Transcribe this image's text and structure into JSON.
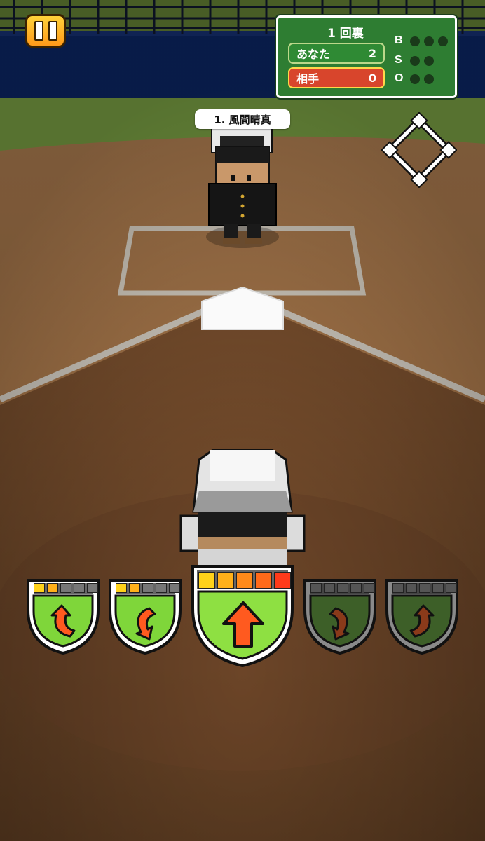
{
  "scoreboard": {
    "inning": "1 回裏",
    "teams": [
      {
        "name": "あなた",
        "score": "2"
      },
      {
        "name": "相手",
        "score": "0"
      }
    ],
    "count_labels": {
      "balls": "B",
      "strikes": "S",
      "outs": "O"
    },
    "balls": 0,
    "strikes": 0,
    "outs": 0
  },
  "batter": {
    "label": "1. 風間晴真"
  },
  "swing_buttons": [
    {
      "name": "swing-left-upper-button",
      "icon": "curve-arrow-left-up-icon",
      "active": true,
      "meter_level": 2
    },
    {
      "name": "swing-left-lower-button",
      "icon": "curve-arrow-left-down-icon",
      "active": true,
      "meter_level": 2
    },
    {
      "name": "swing-straight-button",
      "icon": "straight-arrow-up-icon",
      "active": true,
      "meter_level": 5
    },
    {
      "name": "swing-right-lower-button",
      "icon": "curve-arrow-right-down-icon",
      "active": false,
      "meter_level": 0
    },
    {
      "name": "swing-right-upper-button",
      "icon": "curve-arrow-right-up-icon",
      "active": false,
      "meter_level": 0
    }
  ],
  "colors": {
    "scoreboard_bg": "#2e7d32",
    "opponent_row": "#d8452c",
    "button_green": "#6fcf3a",
    "button_disabled": "#3d5f28",
    "arrow_orange": "#ff5a1f"
  }
}
